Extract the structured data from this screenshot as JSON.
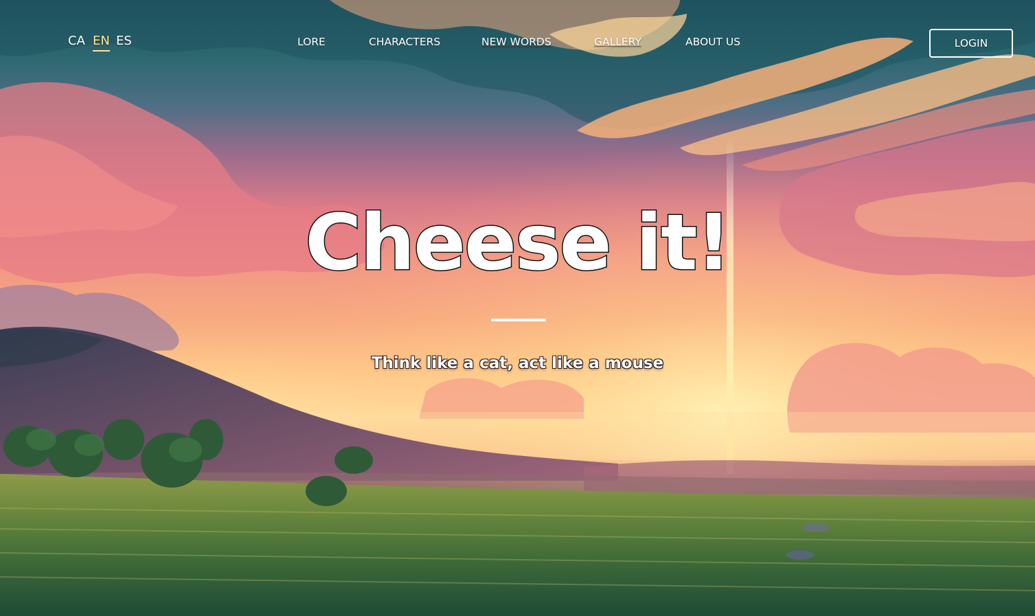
{
  "languages": [
    {
      "label": "CA",
      "active": false
    },
    {
      "label": "EN",
      "active": true
    },
    {
      "label": "ES",
      "active": false
    }
  ],
  "nav": {
    "items": [
      {
        "label": "LORE"
      },
      {
        "label": "CHARACTERS"
      },
      {
        "label": "NEW WORDS"
      },
      {
        "label": "GALLERY"
      },
      {
        "label": "ABOUT US"
      }
    ],
    "login_label": "LOGIN"
  },
  "hero": {
    "title": "Cheese it!",
    "subtitle": "Think like a cat, act like a mouse"
  },
  "colors": {
    "accent": "#ffe49b",
    "text": "#ffffff"
  }
}
